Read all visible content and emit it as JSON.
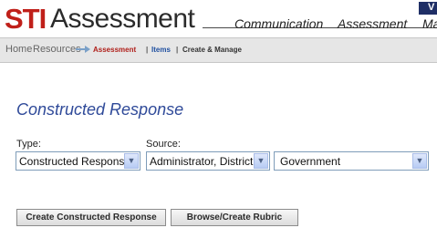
{
  "header": {
    "logo_sti": "STI",
    "logo_assessment": "Assessment",
    "nav": [
      "Communication",
      "Assessment",
      "Ma"
    ],
    "nav_corner": "V"
  },
  "breadcrumb": {
    "home": "Home",
    "resources": "Resources",
    "assessment": "Assessment",
    "sep1": "|",
    "items": "Items",
    "sep2": "|",
    "create_manage": "Create & Manage"
  },
  "page": {
    "title": "Constructed Response"
  },
  "form": {
    "type_label": "Type:",
    "type_value": "Constructed Response",
    "source_label": "Source:",
    "source_value": "Administrator, District",
    "subject_value": "Government"
  },
  "actions": {
    "create_label": "Create Constructed Response",
    "rubric_label": "Browse/Create Rubric"
  },
  "colors": {
    "brand_red": "#c0201a",
    "heading_blue": "#2f4a99"
  }
}
